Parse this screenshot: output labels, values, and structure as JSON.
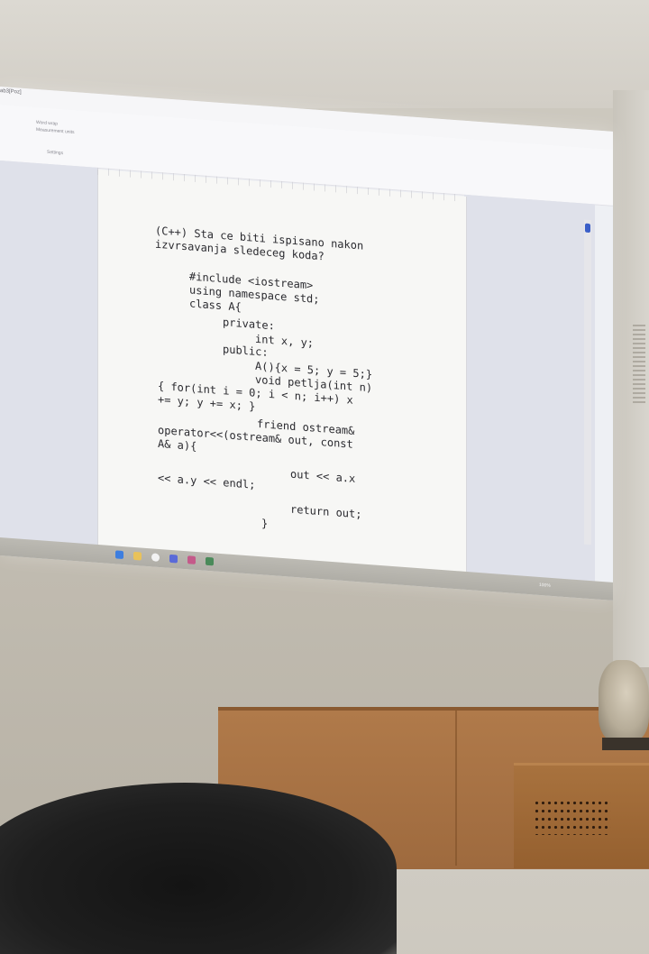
{
  "window": {
    "title_fragment": "ab3[Poz]",
    "ribbon_items": [
      "Word wrap",
      "Measurement units",
      "Settings"
    ],
    "controls": [
      "—",
      "☐",
      "✕"
    ]
  },
  "document": {
    "lines": [
      "(C++) Sta ce biti ispisano nakon",
      "izvrsavanja sledeceg koda?",
      "#include <iostream>",
      "using namespace std;",
      "class A{",
      "private:",
      "int x, y;",
      "public:",
      "A(){x = 5; y = 5;}",
      "void petlja(int n)",
      "{ for(int i = 0; i < n; i++) x",
      "+= y; y += x; }",
      "friend ostream&",
      "operator<<(ostream& out, const",
      "A& a){",
      "out << a.x",
      "<< a.y << endl;",
      "return out;",
      "}"
    ]
  },
  "taskbar": {
    "zoom_label": "100%",
    "icons": [
      "edge-icon",
      "file-explorer-icon",
      "chrome-icon",
      "app-icon",
      "app-icon",
      "app-icon"
    ]
  },
  "colors": {
    "accent": "#3b5fc8",
    "page": "#f7f7f5",
    "pane": "#dfe1ea"
  }
}
